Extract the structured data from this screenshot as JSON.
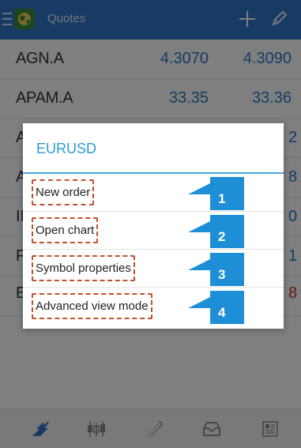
{
  "app": {
    "title": "Quotes"
  },
  "toolbar": {
    "menu_icon": "hamburger-icon",
    "logo_icon": "globe-logo-icon",
    "add_icon": "plus-icon",
    "edit_icon": "pencil-icon"
  },
  "quotes": [
    {
      "symbol": "AGN.A",
      "bid": "4.3070",
      "ask": "4.3090"
    },
    {
      "symbol": "APAM.A",
      "bid": "33.35",
      "ask": "33.36"
    }
  ],
  "peeks": {
    "row3_symbol": "A",
    "row3_ask": "2",
    "row4_symbol": "A",
    "row4_ask": "8",
    "row5_symbol": "II",
    "row5_ask": "0",
    "row6_symbol": "F",
    "row6_ask": "1",
    "row7_symbol": "E",
    "row7_ask": "8"
  },
  "dialog": {
    "title": "EURUSD",
    "items": [
      {
        "label": "New order",
        "num": "1"
      },
      {
        "label": "Open chart",
        "num": "2"
      },
      {
        "label": "Symbol properties",
        "num": "3"
      },
      {
        "label": "Advanced view mode",
        "num": "4"
      }
    ]
  },
  "bottom_nav": [
    "quotes-icon",
    "chart-icon",
    "trade-icon",
    "history-icon",
    "news-icon"
  ],
  "colors": {
    "accent": "#2e77c8",
    "dialog_title": "#2e9ad6",
    "callout": "#1e8fd6",
    "highlight_border": "#c0522f",
    "negative": "#c0392b"
  }
}
